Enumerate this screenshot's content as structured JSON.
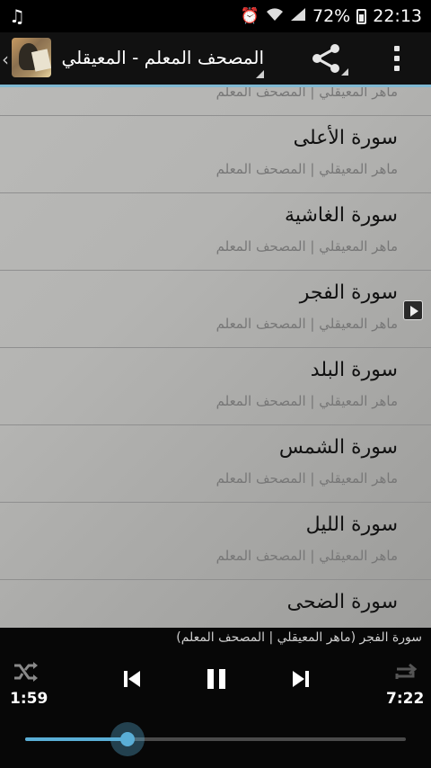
{
  "status_bar": {
    "battery": "72%",
    "time": "22:13"
  },
  "action_bar": {
    "title": "المصحف المعلم - المعيقلي"
  },
  "list": {
    "items": [
      {
        "title": "",
        "subtitle": "ماهر المعيقلي | المصحف المعلم"
      },
      {
        "title": "سورة الأعلى",
        "subtitle": "ماهر المعيقلي | المصحف المعلم"
      },
      {
        "title": "سورة الغاشية",
        "subtitle": "ماهر المعيقلي | المصحف المعلم"
      },
      {
        "title": "سورة الفجر",
        "subtitle": "ماهر المعيقلي | المصحف المعلم",
        "playing": true
      },
      {
        "title": "سورة البلد",
        "subtitle": "ماهر المعيقلي | المصحف المعلم"
      },
      {
        "title": "سورة الشمس",
        "subtitle": "ماهر المعيقلي | المصحف المعلم"
      },
      {
        "title": "سورة الليل",
        "subtitle": "ماهر المعيقلي | المصحف المعلم"
      },
      {
        "title": "سورة الضحى",
        "subtitle": ""
      }
    ]
  },
  "player": {
    "now_playing": "سورة الفجر (ماهر المعيقلي | المصحف المعلم)",
    "elapsed": "1:59",
    "total": "7:22",
    "progress": 0.27
  },
  "colors": {
    "accent": "#5aaed6",
    "divider": "#7fb8d2"
  }
}
